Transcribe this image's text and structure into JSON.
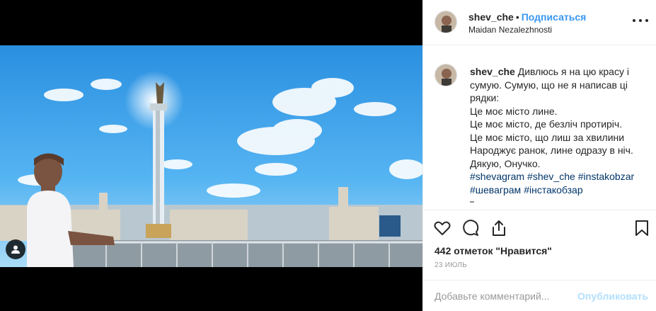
{
  "post": {
    "username": "shev_che",
    "separator": "•",
    "follow_label": "Подписаться",
    "location": "Maidan Nezalezhnosti",
    "more_icon": "more-options-icon",
    "caption_lines": [
      "Дивлюсь я на цю красу і",
      "сумую. Сумую, що не я написав ці",
      "рядки:",
      "Це моє місто лине.",
      "Це моє місто, де безліч протиріч.",
      "Це моє місто, що лиш за хвилини",
      "Народжує ранок, лине одразу в ніч.",
      "Дякую, Онучко."
    ],
    "hashtags_line1": [
      "#shevagram",
      "#shev_che",
      "#instakobzar"
    ],
    "hashtags_line2": [
      "#шеваграм",
      "#інстакобзар"
    ],
    "likes_text": "442 отметок \"Нравится\"",
    "date": "23 ИЮЛЬ",
    "comment_placeholder": "Добавьте комментарий...",
    "publish_label": "Опубликовать"
  },
  "icons": {
    "like": "heart-icon",
    "comment": "comment-icon",
    "share": "share-icon",
    "save": "bookmark-icon",
    "tag": "user-tag-icon"
  },
  "colors": {
    "link_blue": "#3897f0",
    "hashtag": "#003569",
    "publish_disabled": "#b2dffc",
    "muted": "#999999"
  }
}
